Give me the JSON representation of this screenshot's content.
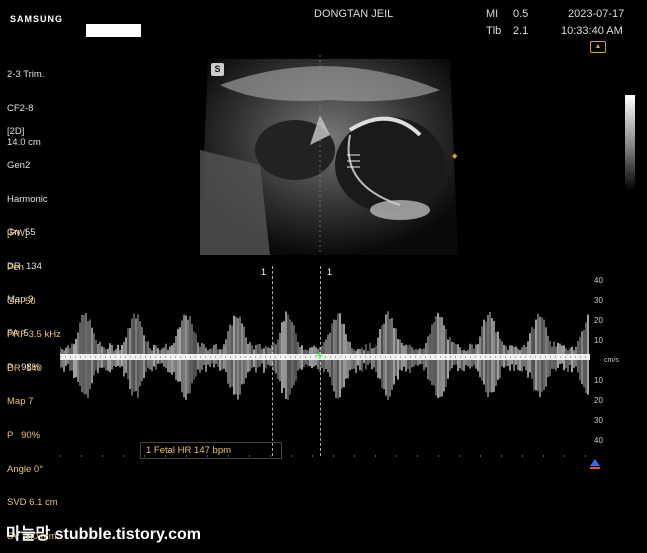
{
  "header": {
    "brand": "SAMSUNG",
    "hospital": "DONGTAN JEIL",
    "mi_label": "MI",
    "mi_value": "0.5",
    "tib_label": "Tlb",
    "tib_value": "2.1",
    "date": "2023-07-17",
    "time": "10:33:40 AM"
  },
  "probe": {
    "preset": "2-3 Trim.",
    "transducer": "CF2-8",
    "depth": "14.0 cm"
  },
  "mode_2d": {
    "title": "[2D]",
    "lines": [
      "Gen2",
      "Harmonic",
      "Gn  55",
      "DR  134",
      "Map 9",
      "FA  5",
      "P   98%"
    ]
  },
  "mode_pw": {
    "title": "[PW]",
    "lines": [
      "Pen",
      "Gn  50",
      "PRF 3.5 kHz",
      "DR  140",
      "Map 7",
      "P   90%",
      "Angle 0°",
      "SVD 6.1 cm",
      "SV  3.0 mm"
    ]
  },
  "icons": {
    "probe_orientation": "probe-orientation-icon",
    "s_marker": "S",
    "focus": "focus-marker-icon"
  },
  "doppler": {
    "cursor_label_left": "1",
    "cursor_label_right": "1",
    "scale_ticks": [
      "40",
      "30",
      "20",
      "10",
      "10",
      "20",
      "30",
      "40"
    ],
    "units": "cm/s",
    "measurement": "1  Fetal HR  147 bpm"
  },
  "footer": {
    "watermark": "마늘망 stubble.tistory.com"
  }
}
